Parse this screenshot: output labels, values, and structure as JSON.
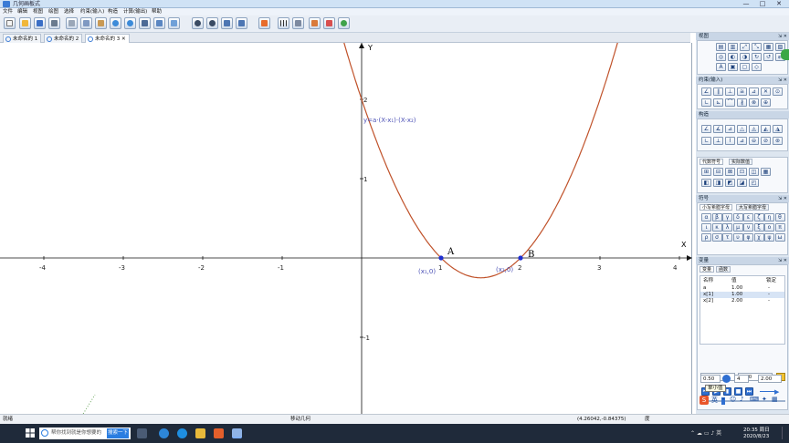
{
  "window": {
    "title": "几何画板式",
    "min": "—",
    "max": "□",
    "close": "✕"
  },
  "menu": [
    "文件",
    "编辑",
    "视图",
    "绘图",
    "选择",
    "约束(输入)",
    "构造",
    "计算(输出)",
    "帮助"
  ],
  "toolbar_icons": [
    "new-icon",
    "open-icon",
    "save-icon",
    "print-icon",
    "cut-icon",
    "copy-icon",
    "paste-icon",
    "undo-icon",
    "redo-icon",
    "zoom-in-icon",
    "zoom-out-icon",
    "fit-icon",
    "grid-icon",
    "animate-icon",
    "help-icon"
  ],
  "doc_tabs": [
    "未命名的 1",
    "未命名的 2",
    "未命名的 3"
  ],
  "active_tab_index": 2,
  "graph": {
    "axis_x_label": "X",
    "axis_y_label": "Y",
    "x_ticks": [
      "-4",
      "-3",
      "-2",
      "-1",
      "1",
      "2",
      "3",
      "4"
    ],
    "y_ticks": [
      "2",
      "1",
      "-1"
    ],
    "formula": "y=a·(X-x₁)·(X-x₂)",
    "point_a_label": "A",
    "point_b_label": "B",
    "point_a_coord": "(x₁,0)",
    "point_b_coord": "(x₂,0)",
    "curve_color": "#c0522a",
    "point_color": "#1f2fd1"
  },
  "panel": {
    "view_title": "视图",
    "constraint_title": "约束(输入)",
    "construct_title": "构造",
    "algebra_tabs": [
      "代数符号",
      "实际数值"
    ],
    "symbols_title": "符号",
    "symbol_tabs": [
      "小写希腊字母",
      "大写希腊字母"
    ],
    "greek_row1": [
      "α",
      "β",
      "γ",
      "δ",
      "ε",
      "ζ",
      "η",
      "θ"
    ],
    "greek_row2": [
      "ι",
      "κ",
      "λ",
      "μ",
      "ν",
      "ξ",
      "ο",
      "π"
    ],
    "greek_row3": [
      "ρ",
      "σ",
      "τ",
      "υ",
      "φ",
      "χ",
      "ψ",
      "ω"
    ],
    "variables_title": "变量",
    "variable_tabs": [
      "变量",
      "函数"
    ],
    "var_headers": [
      "名称",
      "值",
      "锁定"
    ],
    "variables": [
      {
        "name": "a",
        "value": "1.00",
        "lock": "-"
      },
      {
        "name": "x[1]",
        "value": "1.00",
        "lock": "-"
      },
      {
        "name": "x[2]",
        "value": "2.00",
        "lock": "-"
      }
    ],
    "selected_var_name": "x[1]",
    "selected_var_value": "1.00",
    "step_value": "0.50",
    "tooltip": "单小值",
    "frames": "4",
    "end_value": "2.00"
  },
  "status": {
    "left": "就绪",
    "middle": "移动几何",
    "coords": "(4.26042,-0.84375)",
    "unit": "度"
  },
  "taskbar": {
    "search_placeholder": "帮你找到就是你想要的",
    "search_button": "搜索一下",
    "time": "20:35 周日",
    "date": "2020/8/23"
  }
}
